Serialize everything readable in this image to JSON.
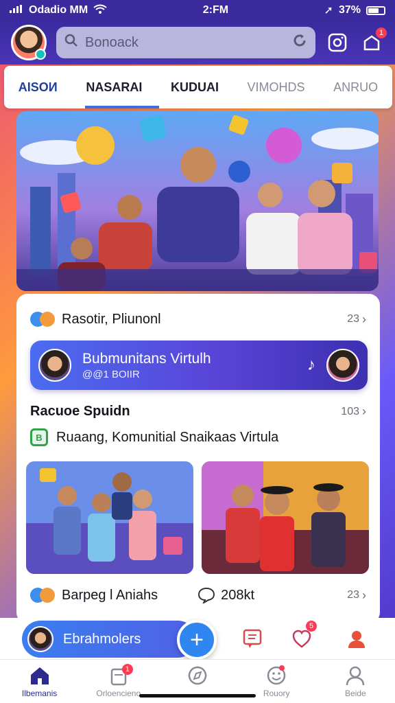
{
  "status": {
    "left_text": "Odadio MM",
    "time": "2:FM",
    "battery": "37%"
  },
  "search": {
    "placeholder": "Bonoack"
  },
  "tabs": [
    {
      "label": "AISOИ"
    },
    {
      "label": "NASARAI"
    },
    {
      "label": "KUDUAI"
    },
    {
      "label": "VIMOHDS"
    },
    {
      "label": "ANRUO"
    }
  ],
  "header": {
    "notif_count": "1"
  },
  "section1": {
    "title": "Rasotir, Pliunonl",
    "count": "23"
  },
  "banner": {
    "title": "Bubmunitans Virtulh",
    "subtitle": "@@1 BOIIR"
  },
  "section2": {
    "title": "Racuoe Spuidn",
    "count": "103",
    "subtitle": "Ruaang, Komunitial Snaikaas Virtula"
  },
  "section3": {
    "title": "Barpeg l Aniahs",
    "comments": "208kt",
    "count": "23"
  },
  "fab": {
    "label": "Ebrahmolers",
    "plus": "+"
  },
  "strip_badges": {
    "gift": "5"
  },
  "nav": [
    {
      "label": "Ilbemanis",
      "icon": "home-icon"
    },
    {
      "label": "Orloencieno",
      "icon": "cards-icon",
      "badge": "1"
    },
    {
      "label": "",
      "icon": "compass-icon"
    },
    {
      "label": "Rouory",
      "icon": "emoji-icon"
    },
    {
      "label": "Beide",
      "icon": "person-icon"
    }
  ],
  "colors": {
    "accent": "#3b6fe0",
    "header": "#3a2a9e",
    "badge": "#ff3b54",
    "fab": "#2f86f0"
  }
}
